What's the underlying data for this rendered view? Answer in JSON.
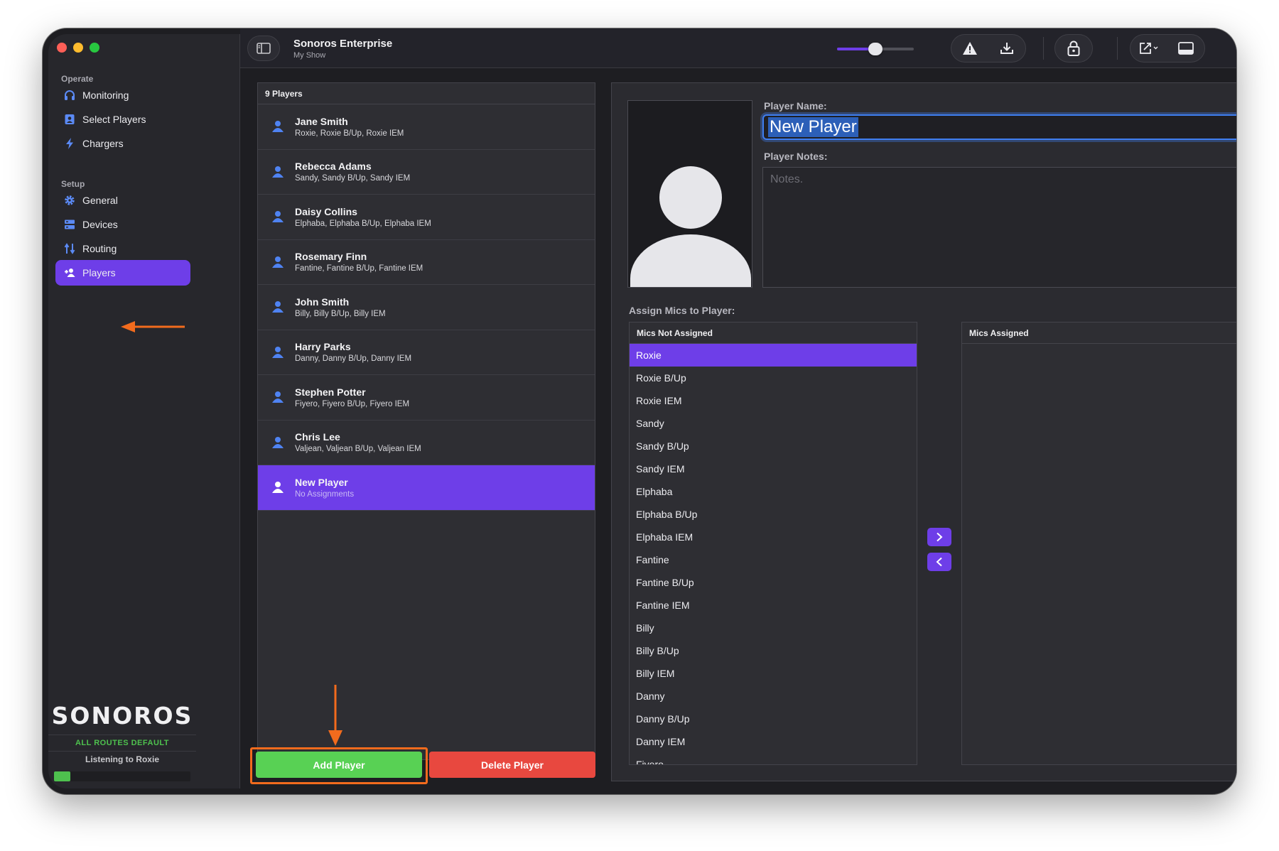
{
  "window": {
    "title": "Sonoros Enterprise",
    "subtitle": "My Show",
    "volume_level": 0.5
  },
  "sidebar": {
    "sections": [
      {
        "label": "Operate"
      },
      {
        "label": "Setup"
      }
    ],
    "items": [
      {
        "label": "Monitoring",
        "icon": "headphones-icon"
      },
      {
        "label": "Select Players",
        "icon": "contact-card-icon"
      },
      {
        "label": "Chargers",
        "icon": "bolt-icon"
      },
      {
        "label": "General",
        "icon": "gear-icon"
      },
      {
        "label": "Devices",
        "icon": "server-icon"
      },
      {
        "label": "Routing",
        "icon": "routing-icon"
      },
      {
        "label": "Players",
        "icon": "add-person-icon",
        "active": true
      }
    ],
    "logo": "SONOROS",
    "routes_status": "ALL ROUTES DEFAULT",
    "listening": "Listening to Roxie",
    "meter_level": 0.12
  },
  "players": {
    "header": "9 Players",
    "items": [
      {
        "name": "Jane Smith",
        "mics": "Roxie, Roxie B/Up, Roxie IEM"
      },
      {
        "name": "Rebecca Adams",
        "mics": "Sandy, Sandy B/Up, Sandy IEM"
      },
      {
        "name": "Daisy Collins",
        "mics": "Elphaba, Elphaba B/Up, Elphaba IEM"
      },
      {
        "name": "Rosemary Finn",
        "mics": "Fantine, Fantine B/Up, Fantine IEM"
      },
      {
        "name": "John Smith",
        "mics": "Billy, Billy B/Up, Billy IEM"
      },
      {
        "name": "Harry Parks",
        "mics": "Danny, Danny B/Up, Danny IEM"
      },
      {
        "name": "Stephen Potter",
        "mics": "Fiyero, Fiyero B/Up, Fiyero IEM"
      },
      {
        "name": "Chris Lee",
        "mics": "Valjean, Valjean B/Up, Valjean IEM"
      },
      {
        "name": "New Player",
        "mics": "No Assignments",
        "selected": true
      }
    ],
    "add_label": "Add Player",
    "delete_label": "Delete Player"
  },
  "detail": {
    "name_label": "Player Name:",
    "name_value": "New Player",
    "notes_label": "Player Notes:",
    "notes_placeholder": "Notes.",
    "assign_label": "Assign Mics to Player:",
    "not_assigned_header": "Mics Not Assigned",
    "assigned_header": "Mics Assigned",
    "not_assigned": [
      "Roxie",
      "Roxie B/Up",
      "Roxie IEM",
      "Sandy",
      "Sandy B/Up",
      "Sandy IEM",
      "Elphaba",
      "Elphaba B/Up",
      "Elphaba IEM",
      "Fantine",
      "Fantine B/Up",
      "Fantine IEM",
      "Billy",
      "Billy B/Up",
      "Billy IEM",
      "Danny",
      "Danny B/Up",
      "Danny IEM",
      "Fiyero"
    ],
    "assigned": []
  },
  "colors": {
    "accent": "#6e3ee8",
    "add_button": "#58d154",
    "delete_button": "#e8483f",
    "annotation_arrow": "#f26b1d"
  }
}
